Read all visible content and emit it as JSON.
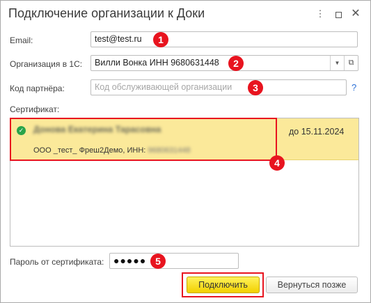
{
  "window": {
    "title": "Подключение организации к Доки",
    "menu_glyph": "⋮",
    "close_glyph": "✕"
  },
  "email": {
    "label": "Email:",
    "value": "test@test.ru"
  },
  "organization": {
    "label": "Организация в 1С:",
    "value": "Вилли Вонка ИНН 9680631448",
    "dropdown_glyph": "▼",
    "open_glyph": "⧉"
  },
  "partner_code": {
    "label": "Код партнёра:",
    "placeholder": "Код обслуживающей организации",
    "help": "?"
  },
  "certificate": {
    "label": "Сертификат:",
    "items": [
      {
        "name": "Донова Екатерина Тарасовна",
        "org": "ООО _тест_ Фреш2Демо, ИНН:",
        "inn": "9680631448",
        "valid_until": "до 15.11.2024",
        "check": "✓"
      }
    ]
  },
  "password": {
    "label": "Пароль от сертификата:",
    "value": "●●●●●"
  },
  "buttons": {
    "connect": "Подключить",
    "later": "Вернуться позже"
  },
  "badges": [
    "1",
    "2",
    "3",
    "4",
    "5"
  ],
  "colors": {
    "badge": "#e8141f",
    "selection": "#fbe99a",
    "primary_button": "#f2d000",
    "help": "#2a6fd6"
  }
}
